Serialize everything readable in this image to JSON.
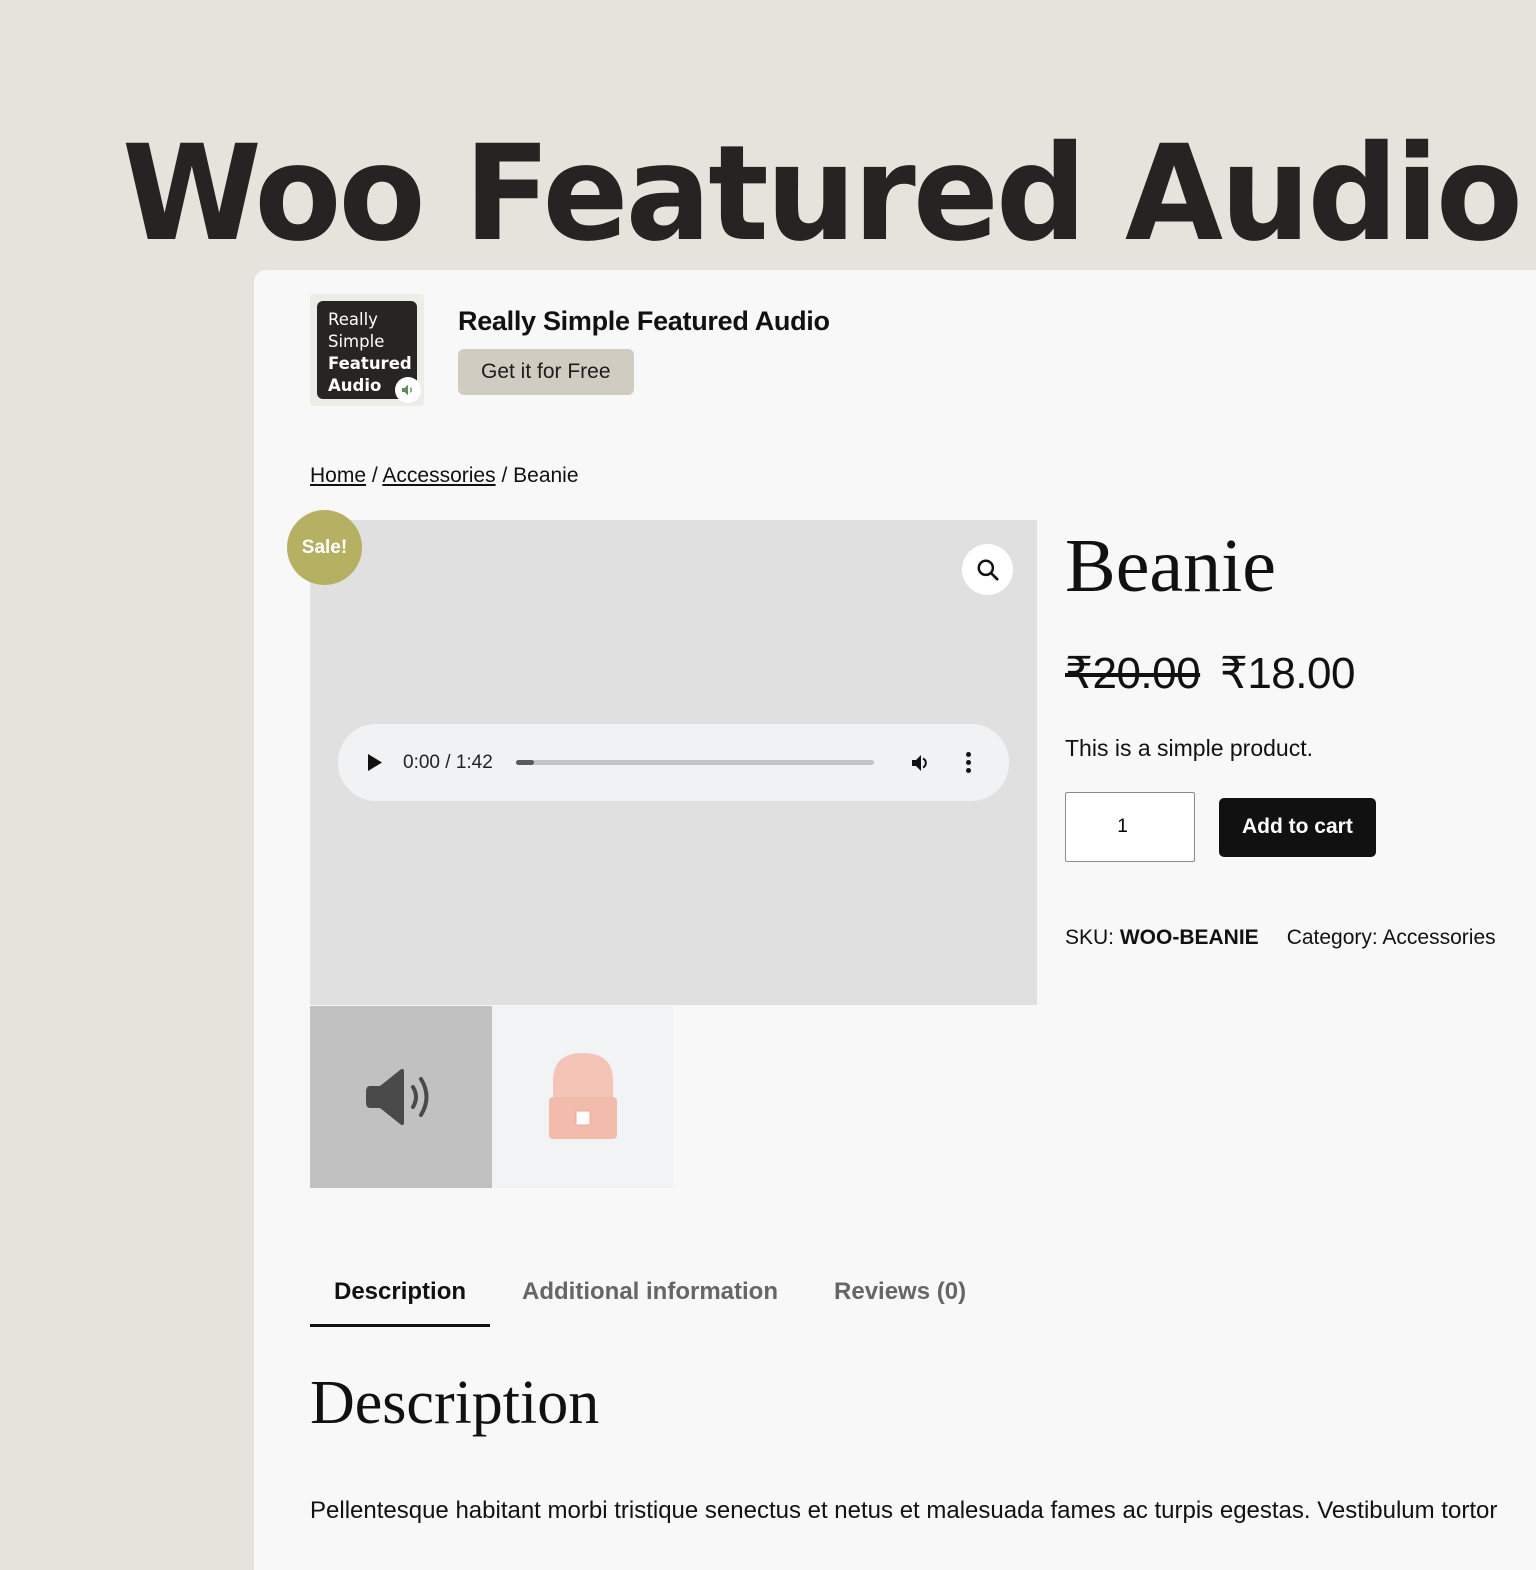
{
  "hero": {
    "title": "Woo Featured Audio"
  },
  "plugin": {
    "logo_lines": [
      "Really",
      "Simple",
      "Featured",
      "Audio"
    ],
    "name": "Really Simple Featured Audio",
    "cta_label": "Get it for Free",
    "logo_icon": "speaker-icon"
  },
  "breadcrumb": {
    "items": [
      {
        "label": "Home",
        "link": true
      },
      {
        "label": "Accessories",
        "link": true
      },
      {
        "label": "Beanie",
        "link": false
      }
    ],
    "separator": "/"
  },
  "gallery": {
    "sale_badge": "Sale!",
    "zoom_icon": "search-icon",
    "audio": {
      "current_time": "0:00",
      "duration": "1:42",
      "time_display": "0:00 / 1:42",
      "progress_fraction": 0.05
    },
    "thumbnails": [
      {
        "type": "audio",
        "icon": "speaker-icon"
      },
      {
        "type": "image",
        "alt": "Beanie"
      }
    ]
  },
  "product": {
    "title": "Beanie",
    "regular_price": "₹20.00",
    "sale_price": "₹18.00",
    "short_description": "This is a simple product.",
    "quantity": "1",
    "add_to_cart_label": "Add to cart",
    "sku_label": "SKU:",
    "sku": "WOO-BEANIE",
    "category_label": "Category:",
    "category": "Accessories"
  },
  "tabs": [
    {
      "label": "Description",
      "active": true
    },
    {
      "label": "Additional information",
      "active": false
    },
    {
      "label": "Reviews (0)",
      "active": false
    }
  ],
  "description": {
    "heading": "Description",
    "text": "Pellentesque habitant morbi tristique senectus et netus et malesuada fames ac turpis egestas. Vestibulum tortor"
  },
  "colors": {
    "page_bg": "#e6e3dd",
    "card_bg": "#f8f8f8",
    "sale_badge": "#b5b062",
    "cta_bg": "#d0ccc2",
    "add_to_cart_bg": "#111111"
  }
}
